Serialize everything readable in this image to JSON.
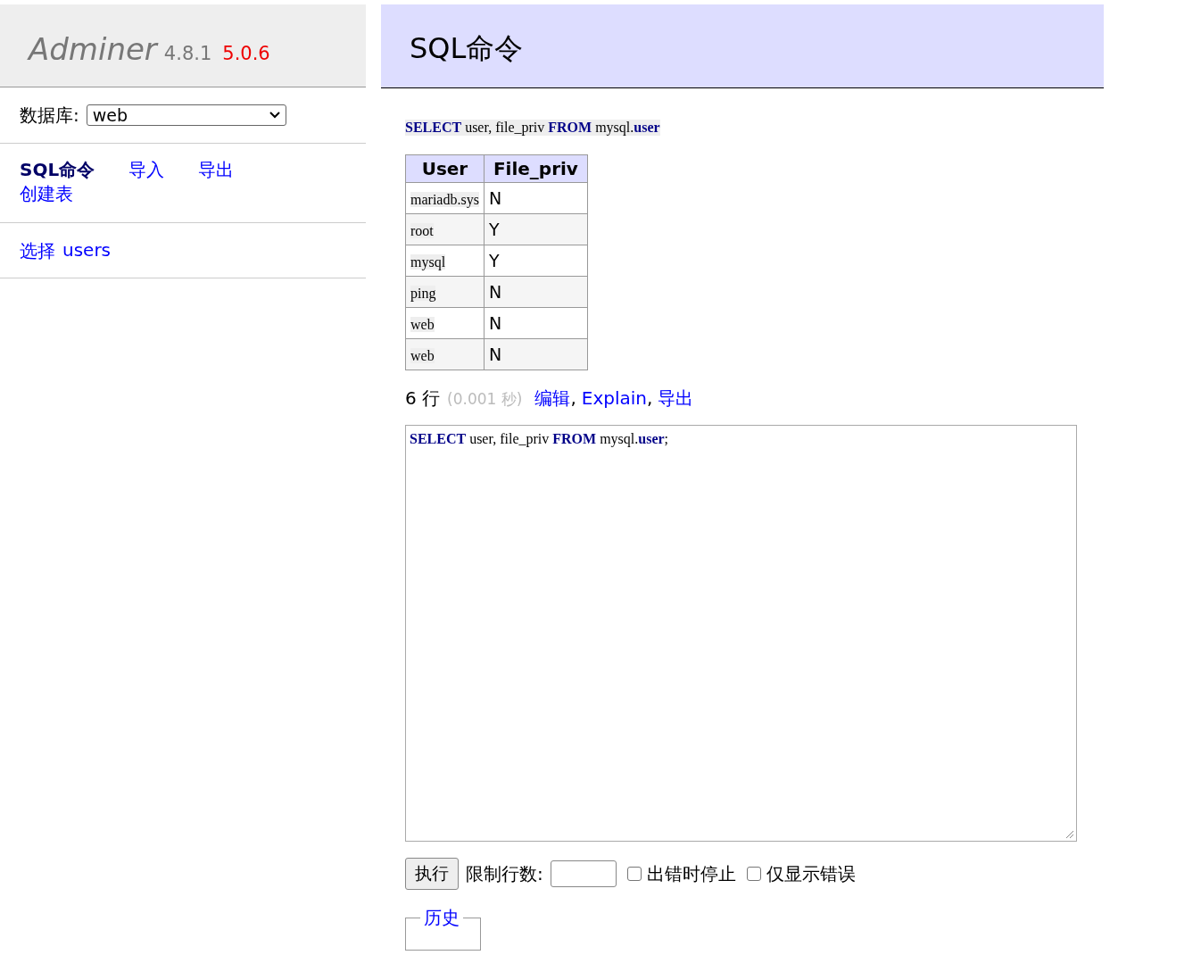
{
  "sidebar": {
    "logo": {
      "name": "Adminer",
      "version": "4.8.1",
      "new_version": "5.0.6"
    },
    "database": {
      "label": "数据库:",
      "value": "web"
    },
    "links": [
      {
        "label": "SQL命令",
        "selected": true
      },
      {
        "label": "导入",
        "selected": false
      },
      {
        "label": "导出",
        "selected": false
      },
      {
        "label": "创建表",
        "selected": false
      }
    ],
    "tables": [
      {
        "action": "选择",
        "name": "users"
      }
    ]
  },
  "main": {
    "title": "SQL命令",
    "query": "**SELECT** user, file_priv **FROM** mysql.**user**",
    "table": {
      "columns": [
        "User",
        "File_priv"
      ],
      "rows": [
        [
          "mariadb.sys",
          "N"
        ],
        [
          "root",
          "Y"
        ],
        [
          "mysql",
          "Y"
        ],
        [
          "ping",
          "N"
        ],
        [
          "web",
          "N"
        ],
        [
          "web",
          "N"
        ]
      ]
    },
    "summary": {
      "rows": "6 行",
      "time": "(0.001 秒)",
      "links": [
        "编辑",
        "Explain",
        "导出"
      ],
      "separator": ","
    },
    "editor": {
      "value": "**SELECT** user, file_priv **FROM** mysql.**user**;"
    },
    "execute_button": "执行",
    "limit": {
      "label": "限制行数:"
    },
    "options": [
      {
        "label": "出错时停止",
        "checked": false
      },
      {
        "label": "仅显示错误",
        "checked": false
      }
    ],
    "history": "历史"
  }
}
